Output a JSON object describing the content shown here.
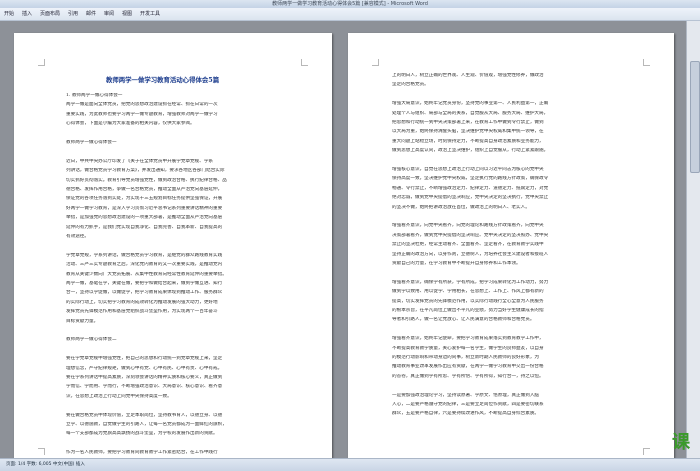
{
  "window": {
    "title": "教师两学一做学习教育活动心得体会5篇 [兼容模式] - Microsoft Word"
  },
  "menu": {
    "items": [
      "开始",
      "插入",
      "页面布局",
      "引用",
      "邮件",
      "审阅",
      "视图",
      "开发工具"
    ]
  },
  "left_page": {
    "heading": "教师两学一做学习教育活动心得体会5篇",
    "lines": [
      "1.     教师两学一做心得体会一",
      "两学一做是面向全体党员，把党的思想政治建设抓在经常、抓在日常的一次",
      "重要实践，为此教师也要学习两学一做专题教育，增强教师对两学一做学习",
      "心得体会，下面是小编为大家准备的相关内容，仅供大家参阅。",
      "",
      "教师两学一做心得体会一",
      "",
      "近日，中共中央办公厅印发了《关于在全体党员中开展学党章党规、学系",
      "列讲话，做合格党员学习教育方案》，并发出通知，要求各地区各部门结合实际",
      "切实抓好贯彻落实。教育引导党员增强党性，做到政治合格、执行纪律合格、品",
      "德合格、发挥作用合格，争做一名合格党员，推动全面从严治党向基层延伸，",
      "保证党的各项任务落到实处，为实现十三五规划目标任务提供坚强保证，开展",
      "好两学一做学习教育，是深入学习贯彻习近平总书记系列重要讲话精神的重要",
      "举措，是加强党的思想政治建设的一项重大部署，是推动全面从严治党向基层",
      "延伸的有力抓手，是我们党实现自我净化、自我完善、自我革新、自我提高的",
      "有效途径。",
      "",
      "学党章党规，学系列讲话，做合格党员学习教育，是继党的群众路线教育实践",
      "活动、三严三实专题教育之后，深化党内教育的又一次重要实践，是推动党内",
      "教育从关键少数向广大党员拓展、从集中性教育向经常性教育延伸的重要举措。",
      "两学一做，基础在学，关键在做，要把学和做结合起来，做到学做互进、知行",
      "合一，坚持以学促做，以做促学，把学习教育成果体现到推动工作、服务群众",
      "的实际行动上，切实把学习教育的成效转化为推动发展的强大动力，更好地",
      "发挥党员先锋模范作用和基层党组织战斗堡垒作用，为实现两个一百年奋斗",
      "目标贡献力量。",
      "",
      "教师两学一做心得体会二",
      "",
      "要在学党章党规中增强党性，把自己的思想和行动统一到党章党规上来，坚定",
      "理想信念，严守纪律规矩，做到心中有党、心中有民、心中有责、心中有戒。",
      "要在学系列讲话中提高素质，深刻领会讲话的精神实质和核心要义，真正做到",
      "学而信、学而用、学而行，不断增强政治意识、大局意识、核心意识、看齐意",
      "识，在思想上政治上行动上同党中央保持高度一致。",
      "",
      "要在做合格党员中体现价值，立足本职岗位，坚持教书育人，以德立身、以德",
      "立学、以德施教，自觉做学生的引路人，让每一名党员都成为一面鲜红的旗帜，",
      "每一个支部都成为党旗高高飘扬的战斗堡垒，为学校的发展作出新的贡献。",
      "",
      "作为一名人民教师，要把学习教育同教育教学工作紧密结合，在工作中践行",
      "党员的职责和使命，爱岗敬业、严谨治学、为人师表，努力做一名合格党员。"
    ]
  },
  "right_page": {
    "lines": [
      "上的明白人，树立正确的世界观、人生观、价值观，增强党性修养，做政治",
      "坚定的合格党员。",
      "",
      "增强大局意识，始终牢记党员身份，坚持党的事业第一、人民利益第一，正确",
      "处理个人与组织、局部与全局的关系，自觉服从大局、服务大局、维护大局，",
      "把思想和行动统一到中央决策部署上来，在教育工作中做到令行禁止，做到",
      "以大局为重，始终保持清醒头脑，坚决维护党中央权威和集中统一领导，在",
      "重大问题上站稳立场，时刻保持定力，不断提高自身政治素质和业务能力，",
      "做到思想上高度认同，政治上坚决维护，组织上自觉服从，行动上紧紧跟随。",
      "",
      "增强核心意识，自觉在思想上政治上行动上同以习近平同志为核心的党中央",
      "保持高度一致，坚决维护党中央权威，坚定执行党的路线方针政策，确保政令",
      "畅通、令行禁止，不断增强政治定力、纪律定力、道德定力、抵腐定力，对党",
      "绝对忠诚，做到党中央提倡的坚决响应，党中央决定的坚决执行，党中央禁止",
      "的坚决不做，始终把讲政治放在首位，做政治上的明白人、老实人。",
      "",
      "增强看齐意识，向党中央看齐，向党的理论和路线方针政策看齐，向党中央",
      "决策部署看齐，做到党中央提倡的坚决响应、党中央决定的坚决照办、党中央",
      "禁止的坚决杜绝，经常主动看齐、全面看齐、坚定看齐，在教育教学实践中",
      "坚持正确的政治方向，以身作则，立德树人，为培养社会主义建设者和接班人",
      "贡献自己的力量，在学习教育中不断提升自身修养和工作本领。",
      "",
      "增强看齐意识，确保学有所获，学有所成，把学习成果转化为工作动力，努力",
      "做到学以致用、用以促学、学用相长，在思想上、工作上、作风上都有新的",
      "提高，切实发挥党员的先锋模范作用，以实际行动践行全心全意为人民服务",
      "的根本宗旨，在平凡岗位上做出不平凡的业绩，努力当好学生健康成长的指",
      "导者和引路人，做一名让党放心、让人民满意的合格教师和合格党员。",
      "",
      "增强看齐意识，始终牢记使命，要把学习教育成果落实到教育教学工作中，",
      "不断提高教育教学质量，关心爱护每一名学生，做学生的良师益友，以自身",
      "的模范行动影响和带动身边的同事，树立新时期人民教师的良好形象，为",
      "推动教育事业改革发展作出应有贡献，在两学一做学习教育中交出一份合格",
      "的答卷，真正做到学有所思、学有所悟、学有所得，知行合一，持之以恒。",
      "",
      "一是要加强政治理论学习，坚持读原著、学原文、悟原理，真正做到入脑",
      "入心，二是要严格遵守党的纪律，三是要立足岗位作贡献，四是要密切联系",
      "群众，五是要严格自律，六是要持续改进作风，不断提高自身综合素质。"
    ]
  },
  "status_bar": {
    "text": "页面: 1/4  字数: 6,005  中文(中国)  插入"
  },
  "watermark": {
    "text": "课"
  }
}
